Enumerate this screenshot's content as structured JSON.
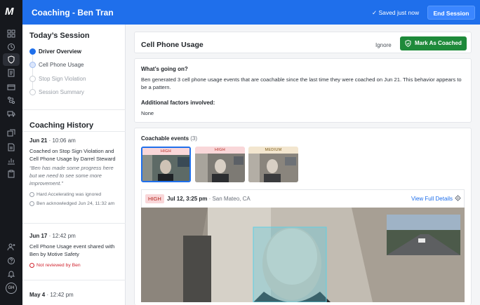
{
  "app": {
    "title": "Coaching - Ben Tran"
  },
  "topbar": {
    "saved_status": "✓  Saved just now",
    "end_session_label": "End Session"
  },
  "nav_rail": {
    "icons": [
      "dashboard-icon",
      "clock-icon",
      "shield-icon",
      "document-icon",
      "card-icon",
      "route-icon",
      "truck-icon",
      "copy-icon",
      "report-icon",
      "chart-icon",
      "clipboard-icon",
      "user-plus-icon",
      "help-icon",
      "bell-icon"
    ],
    "avatar_initials": "GH"
  },
  "session": {
    "heading": "Today’s Session",
    "steps": [
      {
        "label": "Driver Overview",
        "state": "done"
      },
      {
        "label": "Cell Phone Usage",
        "state": "current"
      },
      {
        "label": "Stop Sign Violation",
        "state": "todo"
      },
      {
        "label": "Session Summary",
        "state": "todo"
      }
    ]
  },
  "history": {
    "heading": "Coaching History",
    "entries": [
      {
        "date": "Jun 21",
        "time": " · 10:06 am",
        "body": "Coached on Stop Sign Violation and Cell Phone Usage by Darrel Steward",
        "quote": "“Ben has made some progress here but we need to see some more improvement.”",
        "meta1": "Hard Accelerating was ignored",
        "meta2": "Ben acknowledged Jun 24, 11:32 am"
      },
      {
        "date": "Jun 17",
        "time": " · 12:42 pm",
        "body": "Cell Phone Usage event shared with Ben by Motive Safety",
        "warn": "Not reviewed by Ben"
      },
      {
        "date": "May 4",
        "time": " · 12:42 pm"
      }
    ]
  },
  "main": {
    "title": "Cell Phone Usage",
    "ignore_label": "Ignore",
    "mark_coached_label": "Mark As Coached",
    "whats_going_on_label": "What’s going on?",
    "whats_going_on_text": "Ben generated 3 cell phone usage events that are coachable since the last time they were coached on Jun 21. This behavior appears to be a pattern.",
    "factors_label": "Additional factors involved:",
    "factors_value": "None",
    "events_label": "Coachable events",
    "events_count": "(3)",
    "thumbnails": [
      {
        "severity": "HIGH",
        "selected": true
      },
      {
        "severity": "HIGH",
        "selected": false
      },
      {
        "severity": "MEDIUM",
        "selected": false
      }
    ],
    "event": {
      "severity": "HIGH",
      "datetime": "Jul 12, 3:25 pm",
      "location": " · San Mateo, CA",
      "view_label": "View Full Details"
    }
  },
  "colors": {
    "brand_blue": "#1f6feb",
    "coached_green": "#1e8a3a",
    "high_red": "#b3261e",
    "rail_dark": "#16181d"
  }
}
